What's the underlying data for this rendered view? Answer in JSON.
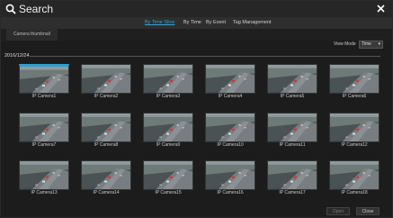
{
  "window": {
    "title": "Search"
  },
  "tabs": [
    {
      "label": "By Time Slice",
      "active": true
    },
    {
      "label": "By Time",
      "active": false
    },
    {
      "label": "By Event",
      "active": false
    },
    {
      "label": "Tag Management",
      "active": false
    }
  ],
  "breadcrumb": {
    "label": "Camera thumbnail"
  },
  "view_mode": {
    "label": "View Mode",
    "selected": "Time"
  },
  "date": "2016/12/24",
  "cameras": [
    "IP Camera1",
    "IP Camera2",
    "IP Camera3",
    "IP Camera4",
    "IP Camera5",
    "IP Camera6",
    "IP Camera7",
    "IP Camera8",
    "IP Camera9",
    "IP Camera10",
    "IP Camera11",
    "IP Camera12",
    "IP Camera13",
    "IP Camera14",
    "IP Camera15",
    "IP Camera16",
    "IP Camera17",
    "IP Camera18"
  ],
  "selected_camera_index": 0,
  "footer": {
    "open_label": "Open",
    "close_label": "Close"
  },
  "colors": {
    "accent": "#2aa7d8"
  }
}
